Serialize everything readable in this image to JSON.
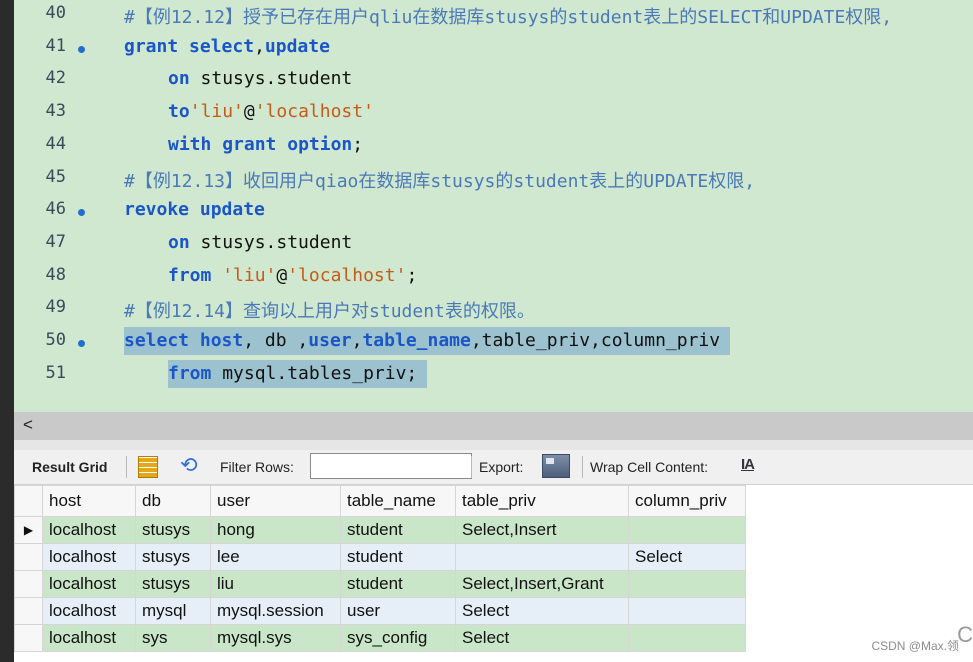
{
  "editor": {
    "lines": [
      {
        "num": "40",
        "breakpoint": false,
        "indent": 0,
        "selected": false,
        "tokens": [
          {
            "t": "#【例12.12】授予已存在用户qliu在数据库stusys的student表上的SELECT和UPDATE权限,",
            "c": "cmt"
          }
        ]
      },
      {
        "num": "41",
        "breakpoint": true,
        "indent": 0,
        "selected": false,
        "tokens": [
          {
            "t": "grant",
            "c": "kw"
          },
          {
            "t": " ",
            "c": ""
          },
          {
            "t": "select",
            "c": "kw"
          },
          {
            "t": ",",
            "c": ""
          },
          {
            "t": "update",
            "c": "kw"
          }
        ]
      },
      {
        "num": "42",
        "breakpoint": false,
        "indent": 1,
        "selected": false,
        "tokens": [
          {
            "t": "on",
            "c": "kw"
          },
          {
            "t": " stusys.student",
            "c": ""
          }
        ]
      },
      {
        "num": "43",
        "breakpoint": false,
        "indent": 1,
        "selected": false,
        "tokens": [
          {
            "t": "to",
            "c": "kw"
          },
          {
            "t": "'liu'",
            "c": "str"
          },
          {
            "t": "@",
            "c": ""
          },
          {
            "t": "'localhost'",
            "c": "str"
          }
        ]
      },
      {
        "num": "44",
        "breakpoint": false,
        "indent": 1,
        "selected": false,
        "tokens": [
          {
            "t": "with",
            "c": "kw"
          },
          {
            "t": " ",
            "c": ""
          },
          {
            "t": "grant",
            "c": "kw"
          },
          {
            "t": " ",
            "c": ""
          },
          {
            "t": "option",
            "c": "kw"
          },
          {
            "t": ";",
            "c": ""
          }
        ]
      },
      {
        "num": "45",
        "breakpoint": false,
        "indent": 0,
        "selected": false,
        "tokens": [
          {
            "t": "#【例12.13】收回用户qiao在数据库stusys的student表上的UPDATE权限,",
            "c": "cmt"
          }
        ]
      },
      {
        "num": "46",
        "breakpoint": true,
        "indent": 0,
        "selected": false,
        "tokens": [
          {
            "t": "revoke",
            "c": "kw"
          },
          {
            "t": " ",
            "c": ""
          },
          {
            "t": "update",
            "c": "kw"
          }
        ]
      },
      {
        "num": "47",
        "breakpoint": false,
        "indent": 1,
        "selected": false,
        "tokens": [
          {
            "t": "on",
            "c": "kw"
          },
          {
            "t": " stusys.student",
            "c": ""
          }
        ]
      },
      {
        "num": "48",
        "breakpoint": false,
        "indent": 1,
        "selected": false,
        "tokens": [
          {
            "t": "from",
            "c": "kw"
          },
          {
            "t": " ",
            "c": ""
          },
          {
            "t": "'liu'",
            "c": "str"
          },
          {
            "t": "@",
            "c": ""
          },
          {
            "t": "'localhost'",
            "c": "str"
          },
          {
            "t": ";",
            "c": ""
          }
        ]
      },
      {
        "num": "49",
        "breakpoint": false,
        "indent": 0,
        "selected": false,
        "tokens": [
          {
            "t": "#【例12.14】查询以上用户对student表的权限。",
            "c": "cmt"
          }
        ]
      },
      {
        "num": "50",
        "breakpoint": true,
        "indent": 0,
        "selected": true,
        "tokens": [
          {
            "t": "select",
            "c": "kw"
          },
          {
            "t": " ",
            "c": ""
          },
          {
            "t": "host",
            "c": "kw"
          },
          {
            "t": ", db ,",
            "c": ""
          },
          {
            "t": "user",
            "c": "kw"
          },
          {
            "t": ",",
            "c": ""
          },
          {
            "t": "table_name",
            "c": "kw"
          },
          {
            "t": ",table_priv,column_priv",
            "c": ""
          }
        ]
      },
      {
        "num": "51",
        "breakpoint": false,
        "indent": 1,
        "selected": true,
        "tokens": [
          {
            "t": "from",
            "c": "kw"
          },
          {
            "t": " mysql.tables_priv;",
            "c": ""
          }
        ]
      }
    ]
  },
  "scrollbar": {
    "left_arrow": "<"
  },
  "toolbar": {
    "result_grid_label": "Result Grid",
    "filter_rows_label": "Filter Rows:",
    "filter_value": "",
    "export_label": "Export:",
    "wrap_label": "Wrap Cell Content:",
    "wrap_icon_glyph": "IA",
    "refresh_glyph": "⟲"
  },
  "grid": {
    "columns": [
      "host",
      "db",
      "user",
      "table_name",
      "table_priv",
      "column_priv"
    ],
    "current_row_marker": "▶",
    "rows": [
      {
        "cells": [
          "localhost",
          "stusys",
          "hong",
          "student",
          "Select,Insert",
          ""
        ]
      },
      {
        "cells": [
          "localhost",
          "stusys",
          "lee",
          "student",
          "",
          "Select"
        ]
      },
      {
        "cells": [
          "localhost",
          "stusys",
          "liu",
          "student",
          "Select,Insert,Grant",
          ""
        ]
      },
      {
        "cells": [
          "localhost",
          "mysql",
          "mysql.session",
          "user",
          "Select",
          ""
        ]
      },
      {
        "cells": [
          "localhost",
          "sys",
          "mysql.sys",
          "sys_config",
          "Select",
          ""
        ]
      }
    ]
  },
  "watermark": "CSDN @Max.领",
  "edge_glyph": "C",
  "colors": {
    "keyword": "#1a56c8",
    "string": "#c65a17",
    "comment": "#4b79b8",
    "editor_bg": "#cfe8cf",
    "selection": "#9cc2cf"
  }
}
